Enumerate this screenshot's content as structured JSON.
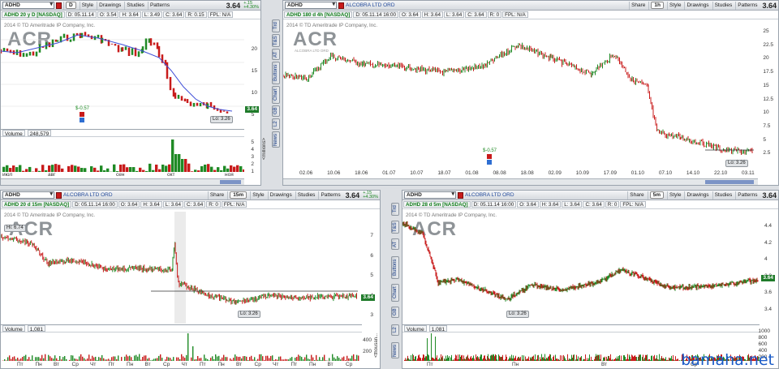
{
  "watermark": "bamaha.net",
  "panels": [
    {
      "symbol": "ADHD",
      "title": "ADHD 20 y D [NASDAQ]",
      "date": "D: 05.11.14",
      "open": "O: 3.54",
      "high": "H: 3.64",
      "low": "L: 3.49",
      "close": "C: 3.64",
      "range": "R: 0.15",
      "fpl": "FPL: N/A",
      "period": "D",
      "style": "Style",
      "drawings": "Drawings",
      "studies": "Studies",
      "patterns": "Patterns",
      "price": "3.64",
      "chg1": "+.15",
      "chg2": "+4.30%",
      "copyright": "2014 © TD Ameritrade IP Company, Inc.",
      "logo": "ACR",
      "y_labels": [
        "20",
        "15",
        "10",
        "5"
      ],
      "last": "3.64",
      "lo": "Lo: 3.26",
      "eps": "$-0.57",
      "volume_label": "Volume",
      "volume": "248,579",
      "vol_axis": [
        "5",
        "4",
        "3",
        "2",
        "1"
      ],
      "vol_unit": "<millions>",
      "x_labels": [
        "июл",
        "авг",
        "сен",
        "окт",
        "ноя"
      ]
    },
    {
      "symbol": "ADHD",
      "company": "ALCOBRA LTD ORD",
      "title": "ADHD 180 d 4h [NASDAQ]",
      "date": "D: 05.11.14 16:00",
      "open": "O: 3.64",
      "high": "H: 3.64",
      "low": "L: 3.64",
      "close": "C: 3.64",
      "range": "R: 0",
      "fpl": "FPL: N/A",
      "share": "Share",
      "period": "1h",
      "style": "Style",
      "drawings": "Drawings",
      "studies": "Studies",
      "patterns": "Patterns",
      "price": "3.64",
      "copyright": "2014 © TD Ameritrade IP Company, Inc.",
      "logo": "ACR",
      "logo_sub": "ALCOBRA LTD ORD",
      "y_labels": [
        "25",
        "22.5",
        "20",
        "17.5",
        "15",
        "12.5",
        "10",
        "7.5",
        "5",
        "2.5"
      ],
      "lo": "Lo: 3.26",
      "eps": "$-0.57",
      "tabs": [
        "Trd",
        "T&S",
        "AT",
        "Buttons",
        "Chart",
        "GB",
        "L2",
        "News"
      ],
      "x_labels": [
        "02.06",
        "10.06",
        "18.06",
        "01.07",
        "10.07",
        "18.07",
        "01.08",
        "08.08",
        "18.08",
        "02.09",
        "10.09",
        "17.09",
        "01.10",
        "07.10",
        "14.10",
        "22.10",
        "03.11"
      ]
    },
    {
      "symbol": "ADHD",
      "company": "ALCOBRA LTD ORD",
      "title": "ADHD 20 d 15m [NASDAQ]",
      "date": "D: 05.11.14 16:00",
      "open": "O: 3.64",
      "high": "H: 3.64",
      "low": "L: 3.64",
      "close": "C: 3.64",
      "range": "R: 0",
      "fpl": "FPL: N/A",
      "share": "Share",
      "period": "15m",
      "style": "Style",
      "drawings": "Drawings",
      "studies": "Studies",
      "patterns": "Patterns",
      "price": "3.64",
      "chg1": "+.15",
      "chg2": "+4.30%",
      "copyright": "2014 © TD Ameritrade IP Company, Inc.",
      "logo": "ACR",
      "hi": "Hi: 6.74",
      "y_labels": [
        "7",
        "6",
        "5",
        "4",
        "3"
      ],
      "last": "3.64",
      "lo": "Lo: 3.26",
      "volume_label": "Volume",
      "volume": "1,081",
      "vol_axis": [
        "400",
        "200"
      ],
      "vol_unit": "<thousan...",
      "x_labels": [
        "Пт",
        "Пн",
        "Вт",
        "Ср",
        "Чт",
        "Пт",
        "Пн",
        "Вт",
        "Ср",
        "Чт",
        "Пт",
        "Пн",
        "Вт",
        "Ср",
        "Чт",
        "Пт",
        "Пн",
        "Вт",
        "Ср"
      ]
    },
    {
      "symbol": "ADHD",
      "company": "ALCOBRA LTD ORD",
      "title": "ADHD 28 d 5m [NASDAQ]",
      "date": "D: 05.11.14 16:00",
      "open": "O: 3.64",
      "high": "H: 3.64",
      "low": "L: 3.64",
      "close": "C: 3.64",
      "range": "R: 0",
      "fpl": "FPL: N/A",
      "share": "Share",
      "period": "5m",
      "style": "Style",
      "drawings": "Drawings",
      "studies": "Studies",
      "patterns": "Patterns",
      "price": "3.64",
      "copyright": "2014 © TD Ameritrade IP Company, Inc.",
      "logo": "ACR",
      "y_labels": [
        "4.4",
        "4.2",
        "4",
        "3.8",
        "3.6",
        "3.4"
      ],
      "last": "3.64",
      "lo": "Lo: 3.26",
      "volume_label": "Volume",
      "volume": "1,081",
      "vol_axis": [
        "1000",
        "800",
        "600",
        "400",
        "200"
      ],
      "tabs": [
        "Trd",
        "T&S",
        "AT",
        "Buttons",
        "Chart",
        "GB",
        "L2",
        "News"
      ],
      "x_labels": [
        "Пт",
        "Пн",
        "Вт",
        "Ср"
      ]
    }
  ],
  "colors": {
    "up": "#1f8a25",
    "down": "#c81b1b",
    "ma": "#3f4fd8"
  }
}
